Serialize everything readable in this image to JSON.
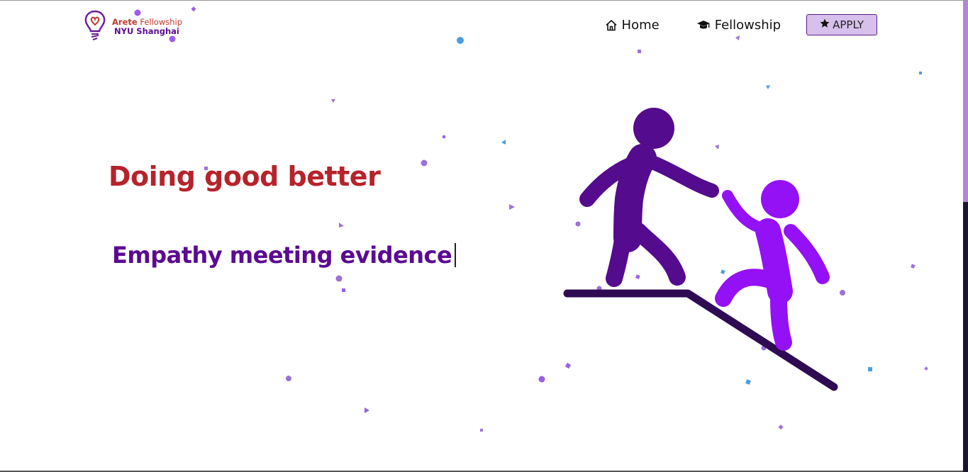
{
  "header": {
    "logo": {
      "line1_bold": "Arete",
      "line1_rest": " Fellowship",
      "line2": "NYU Shanghai",
      "icon": "lightbulb-heart-icon"
    },
    "nav": {
      "home": {
        "label": "Home",
        "icon": "home-icon"
      },
      "fellowship": {
        "label": "Fellowship",
        "icon": "graduation-cap-icon"
      },
      "apply": {
        "label": "APPLY",
        "icon": "star-icon"
      }
    }
  },
  "hero": {
    "title": "Doing good better",
    "subtitle": "Empathy meeting evidence",
    "illustration": "helping-hand-climbers-illustration"
  },
  "colors": {
    "title_red": "#b6232b",
    "brand_purple": "#5b0a91",
    "figure_dark": "#540b8e",
    "figure_light": "#9410f5",
    "ledge": "#2e0b52",
    "apply_bg": "#d8c0ec"
  }
}
